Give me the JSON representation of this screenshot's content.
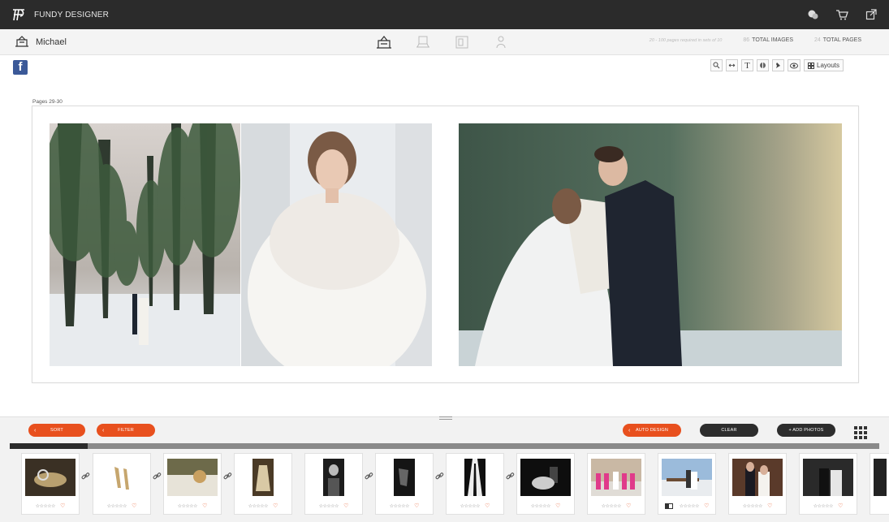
{
  "app": {
    "brand": "FUNDY DESIGNER"
  },
  "topbar": {
    "icons": [
      "support-icon",
      "cart-icon",
      "external-link-icon"
    ]
  },
  "subbar": {
    "client_name": "Michael",
    "requirement": "20 - 100 pages required in sets of 10",
    "total_images_count": "86",
    "total_images_label": "TOTAL IMAGES",
    "total_pages_count": "24",
    "total_pages_label": "TOTAL PAGES",
    "center_icons": [
      "album-icon",
      "proof-icon",
      "layout-icon",
      "share-icon"
    ]
  },
  "toolbar": {
    "layouts_label": "Layouts",
    "text_tool": "T"
  },
  "spread": {
    "pages_label": "Pages 29-30"
  },
  "bottom": {
    "sort_label": "SORT",
    "filter_label": "FILTER",
    "auto_design_label": "AUTO DESIGN",
    "clear_label": "CLEAR",
    "add_photos_label": "+ ADD PHOTOS",
    "progress": 0.09
  },
  "thumbnails": {
    "stars": "☆☆☆☆☆",
    "heart": "♡",
    "items": [
      {
        "desc": "rings"
      },
      {
        "desc": "shoes"
      },
      {
        "desc": "bouquet"
      },
      {
        "desc": "dress"
      },
      {
        "desc": "groom-bw"
      },
      {
        "desc": "groom-detail-bw"
      },
      {
        "desc": "groom-suit-bw"
      },
      {
        "desc": "couple-bw"
      },
      {
        "desc": "bridesmaids"
      },
      {
        "desc": "couple-winter"
      },
      {
        "desc": "couple-portrait"
      },
      {
        "desc": "couple-kiss"
      }
    ]
  },
  "colors": {
    "accent": "#e8501e",
    "dark": "#2b2b2b"
  }
}
